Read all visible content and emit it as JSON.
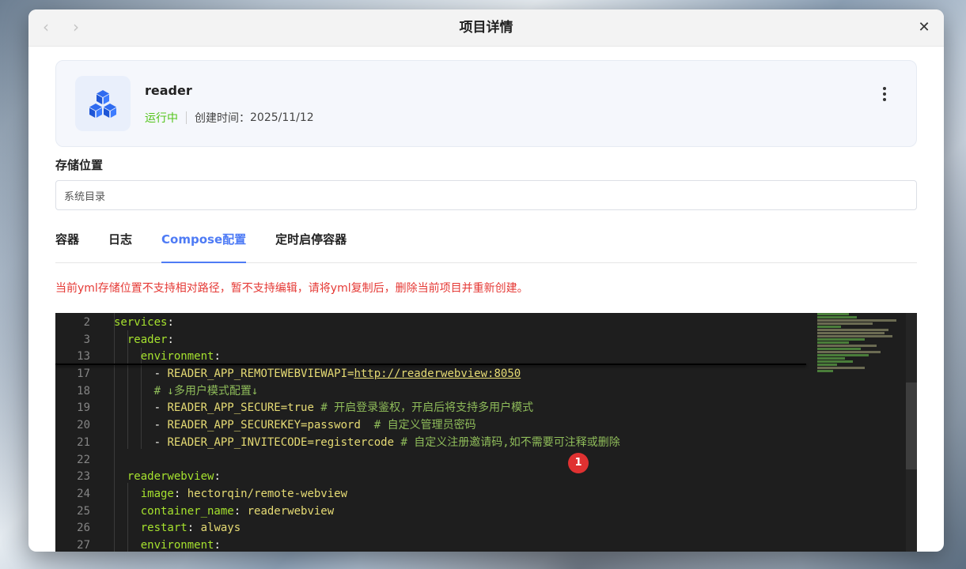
{
  "window": {
    "title": "项目详情",
    "back_icon": "‹",
    "forward_icon": "›",
    "close_icon": "✕"
  },
  "project": {
    "name": "reader",
    "status": "运行中",
    "created_label": "创建时间：",
    "created_date": "2025/11/12",
    "icon": "cubes-icon",
    "status_color": "#52c41a"
  },
  "storage": {
    "label": "存储位置",
    "value": "系统目录"
  },
  "tabs": [
    {
      "label": "容器",
      "active": false
    },
    {
      "label": "日志",
      "active": false
    },
    {
      "label": "Compose配置",
      "active": true
    },
    {
      "label": "定时启停容器",
      "active": false
    }
  ],
  "warning": "当前yml存储位置不支持相对路径，暂不支持编辑，请将yml复制后，删除当前项目并重新创建。",
  "editor": {
    "lines": [
      {
        "n": "2",
        "key": "services"
      },
      {
        "n": "3",
        "key": "reader"
      },
      {
        "n": "13",
        "key": "environment"
      },
      {
        "n": "17",
        "env": "READER_APP_REMOTEWEBVIEWAPI=",
        "url": "http://readerwebview:8050"
      },
      {
        "n": "18",
        "comment": "# ↓多用户模式配置↓"
      },
      {
        "n": "19",
        "env": "READER_APP_SECURE=true",
        "comment": "# 开启登录鉴权，开启后将支持多用户模式"
      },
      {
        "n": "20",
        "env": "READER_APP_SECUREKEY=password",
        "comment": "# 自定义管理员密码"
      },
      {
        "n": "21",
        "env": "READER_APP_INVITECODE=registercode",
        "comment": "# 自定义注册邀请码,如不需要可注释或删除"
      },
      {
        "n": "22"
      },
      {
        "n": "23",
        "key": "readerwebview"
      },
      {
        "n": "24",
        "key": "image",
        "value": "hectorqin/remote-webview"
      },
      {
        "n": "25",
        "key": "container_name",
        "value": "readerwebview"
      },
      {
        "n": "26",
        "key": "restart",
        "value": "always"
      },
      {
        "n": "27",
        "key": "environment"
      }
    ],
    "badge": "1"
  }
}
